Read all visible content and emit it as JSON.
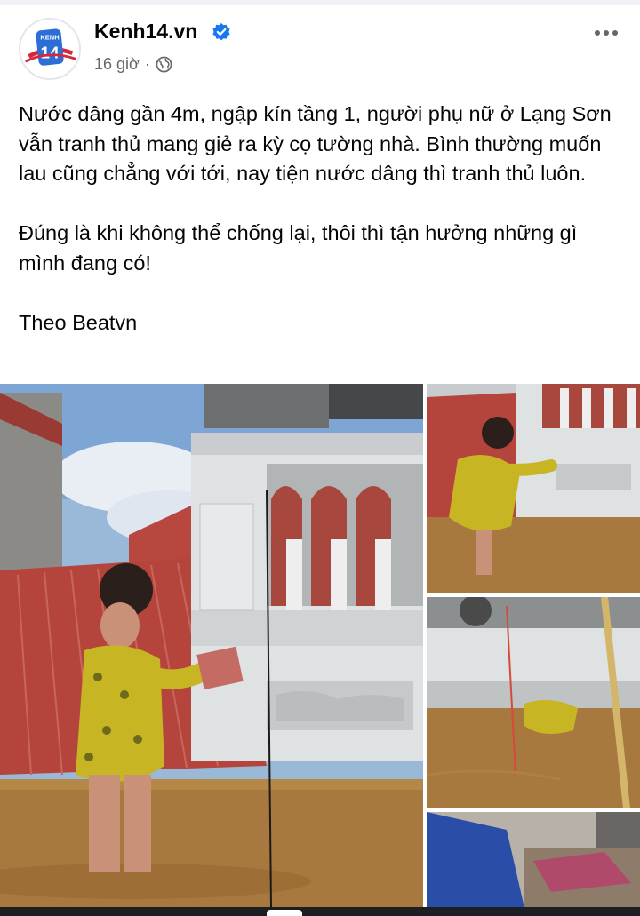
{
  "post": {
    "page_name": "Kenh14.vn",
    "timestamp": "16 giờ",
    "separator": "·",
    "privacy_icon": "globe-icon",
    "verified_icon": "verified-badge-icon",
    "more_icon": "more-options-icon",
    "avatar_logo_text": "KENH",
    "avatar_logo_number": "14",
    "paragraphs": [
      "Nước dâng gần 4m, ngập kín tầng 1, người phụ nữ ở Lạng Sơn vẫn tranh thủ mang giẻ ra kỳ cọ tường nhà. Bình thường muốn lau cũng chẳng với tới, nay tiện nước dâng thì tranh thủ luôn.",
      "Đúng là khi không thể chống lại, thôi thì tận hưởng những gì mình đang có!",
      "Theo Beatvn"
    ]
  },
  "colors": {
    "brand_blue": "#1877f2",
    "secondary_text": "#65676b",
    "roof_red": "#b8473f",
    "flood_water": "#a7793f"
  }
}
